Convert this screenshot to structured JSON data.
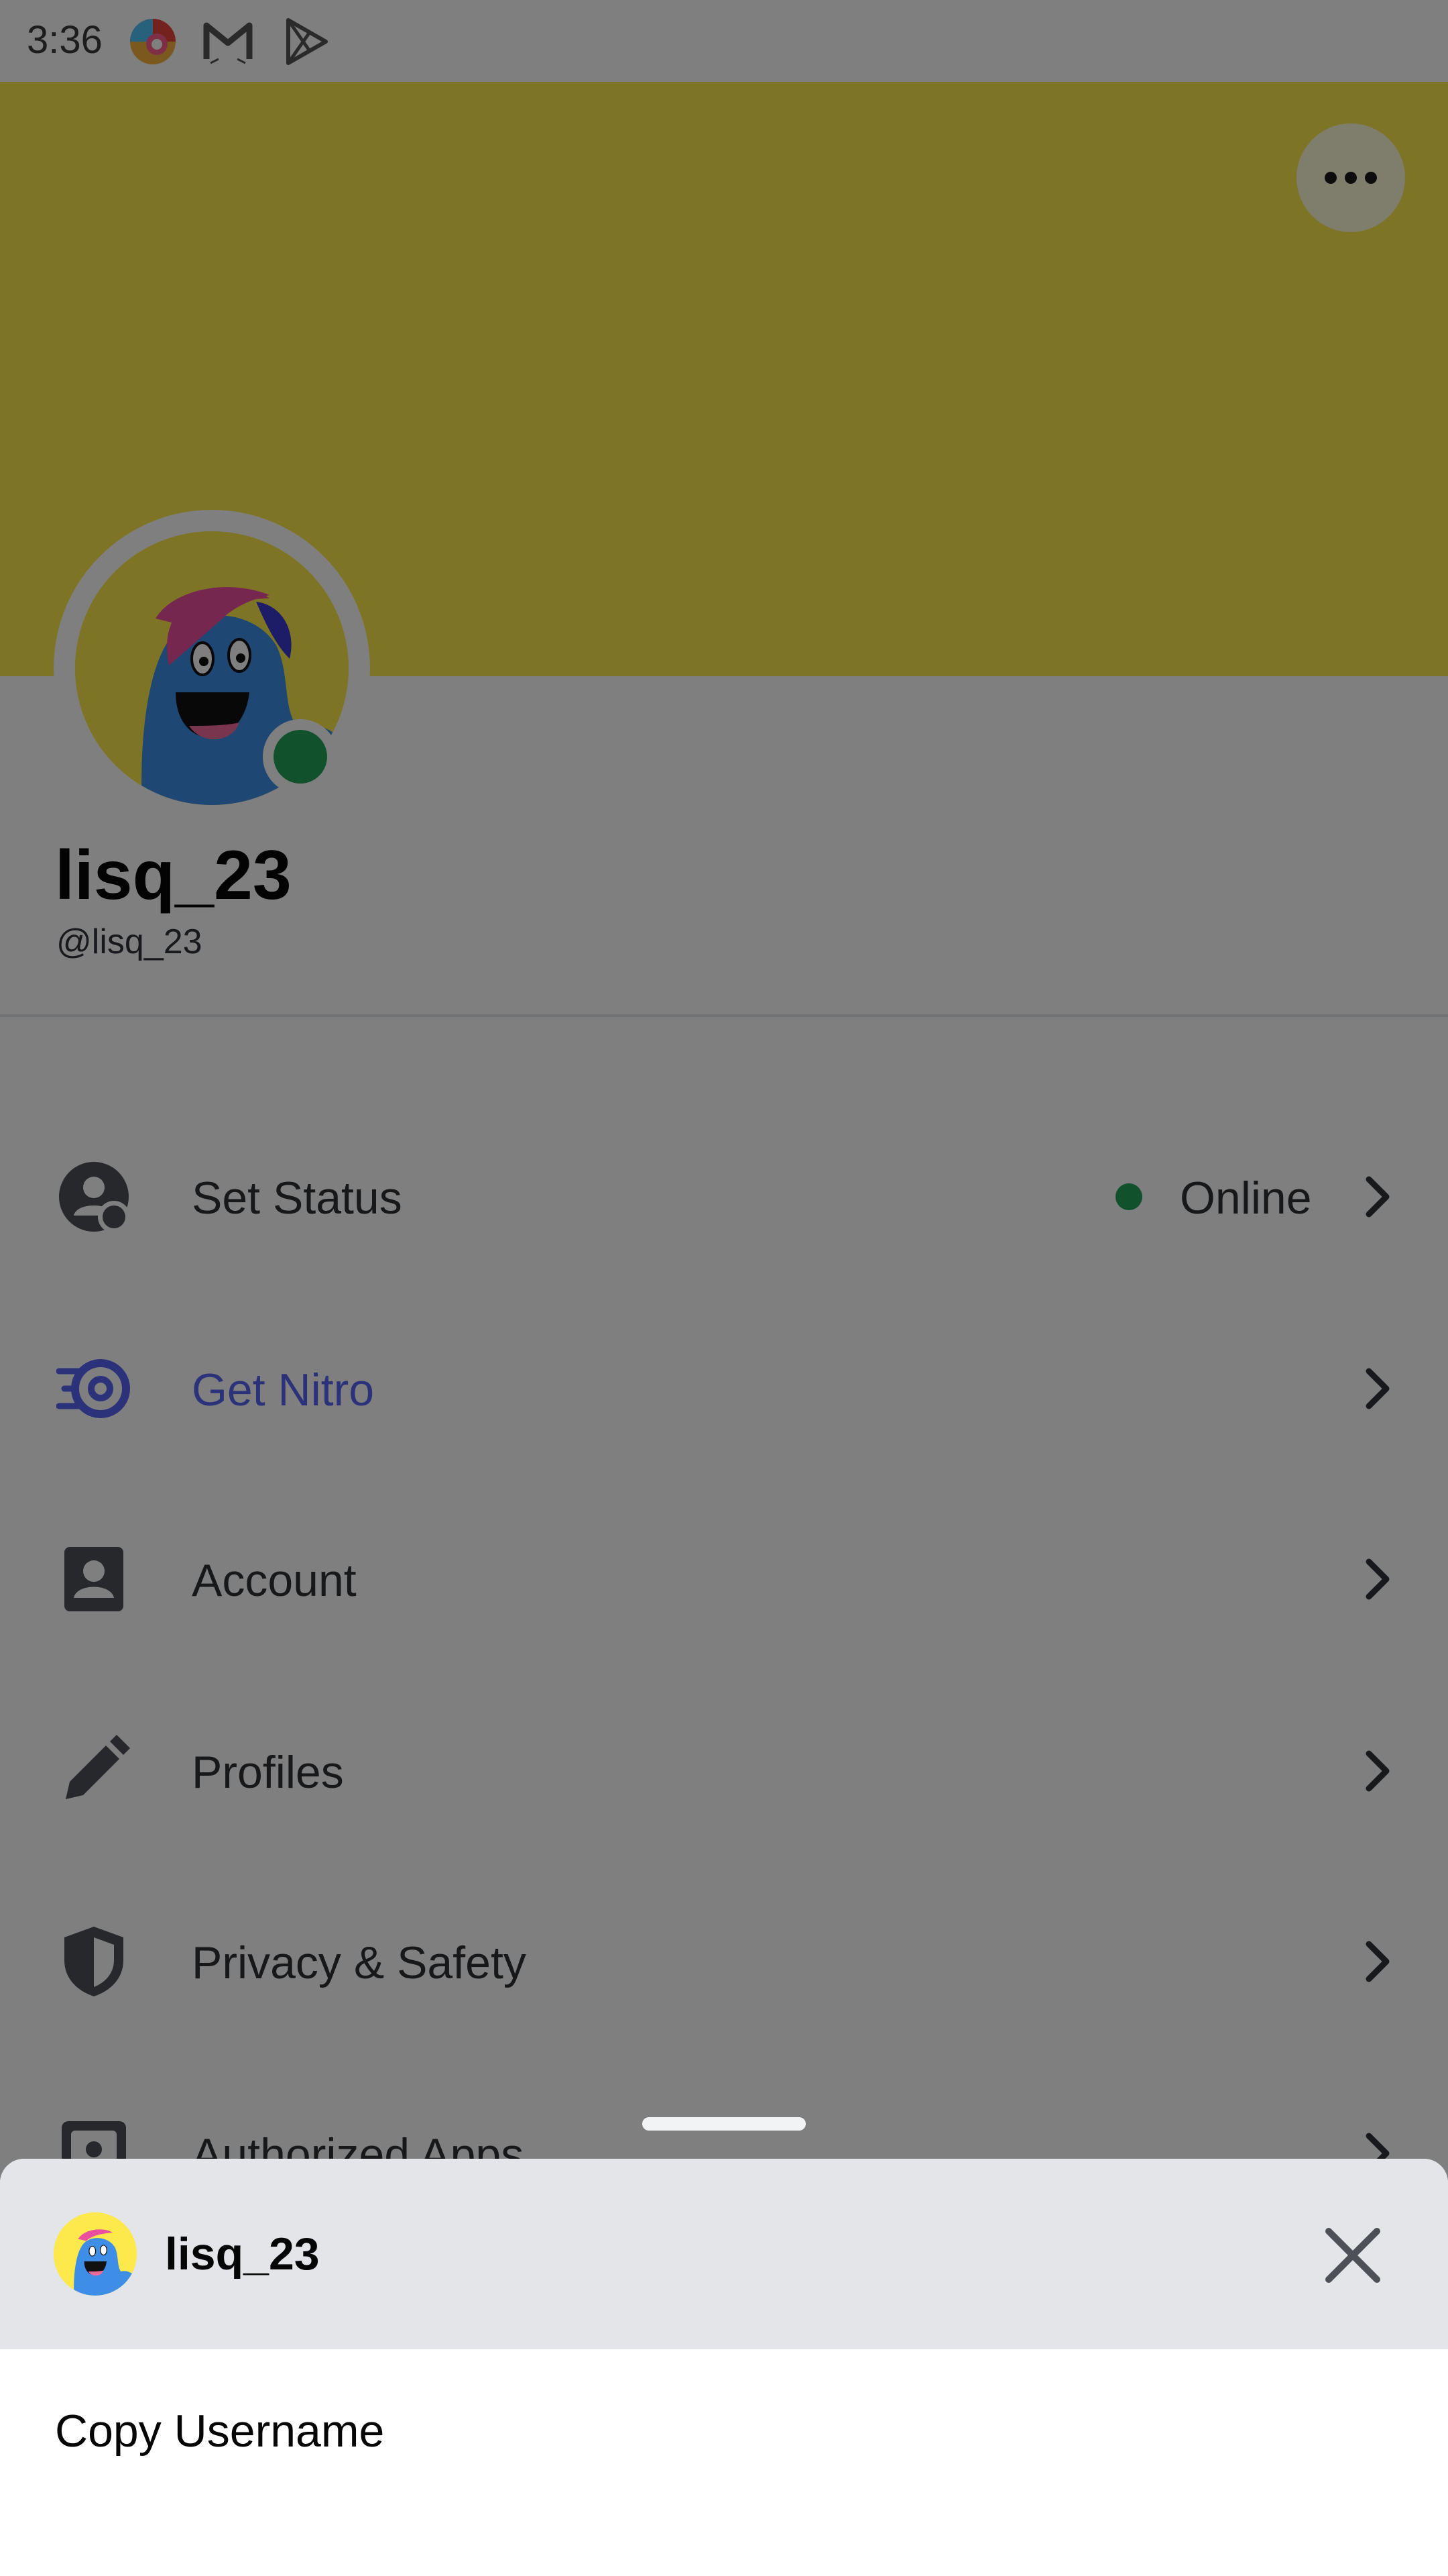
{
  "status_bar": {
    "time": "3:36",
    "icons": [
      "colorful-app-icon",
      "gmail-icon",
      "play-store-icon"
    ]
  },
  "profile": {
    "display_name": "lisq_23",
    "username": "@lisq_23",
    "banner_color": "#fde94b",
    "status_color": "#23a55a"
  },
  "menu": {
    "items": [
      {
        "label": "Set Status",
        "icon": "status-person-icon",
        "value": "Online"
      },
      {
        "label": "Get Nitro",
        "icon": "nitro-icon"
      },
      {
        "label": "Account",
        "icon": "account-icon"
      },
      {
        "label": "Profiles",
        "icon": "pencil-icon"
      },
      {
        "label": "Privacy & Safety",
        "icon": "shield-icon"
      },
      {
        "label": "Authorized Apps",
        "icon": "authorized-apps-icon"
      }
    ]
  },
  "sheet": {
    "name": "lisq_23",
    "items": [
      {
        "label": "Copy Username"
      }
    ]
  },
  "colors": {
    "accent": "#5865f2",
    "online": "#23a55a"
  }
}
